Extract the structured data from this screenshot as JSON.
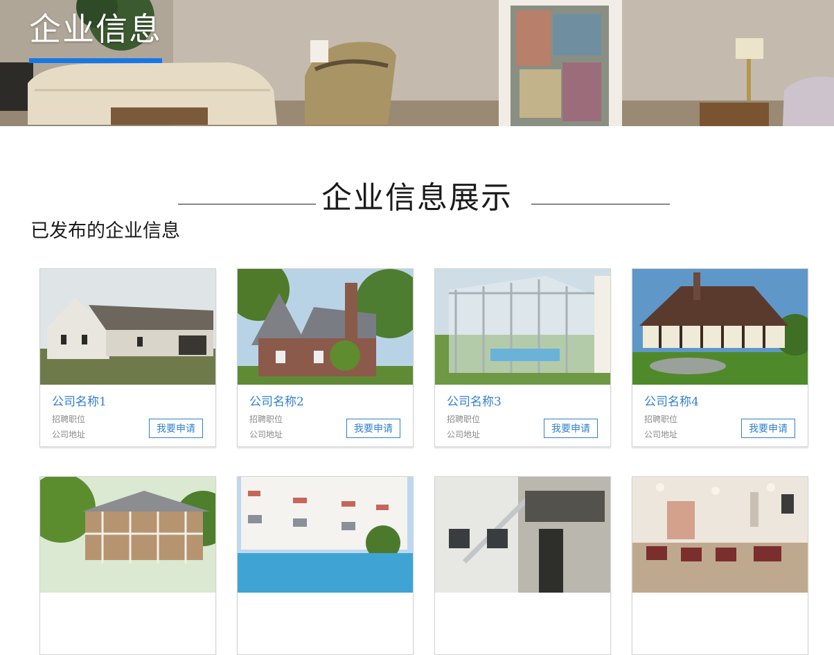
{
  "banner": {
    "title": "企业信息"
  },
  "section": {
    "title": "企业信息展示",
    "subtitle": "已发布的企业信息"
  },
  "cards": [
    {
      "name": "公司名称1",
      "job": "招聘职位",
      "address": "公司地址",
      "apply": "我要申请",
      "image": "old-white-farmhouse"
    },
    {
      "name": "公司名称2",
      "job": "招聘职位",
      "address": "公司地址",
      "apply": "我要申请",
      "image": "brick-cottage"
    },
    {
      "name": "公司名称3",
      "job": "招聘职位",
      "address": "公司地址",
      "apply": "我要申请",
      "image": "glass-pool-enclosure"
    },
    {
      "name": "公司名称4",
      "job": "招聘职位",
      "address": "公司地址",
      "apply": "我要申请",
      "image": "timber-frame-house"
    },
    {
      "image": "house-with-screened-porch"
    },
    {
      "image": "apartment-pool"
    },
    {
      "image": "white-building-balconies"
    },
    {
      "image": "restaurant-interior"
    }
  ],
  "colors": {
    "accent": "#1577e8",
    "link": "#2f7fd1",
    "muted": "#8a8a8a"
  }
}
